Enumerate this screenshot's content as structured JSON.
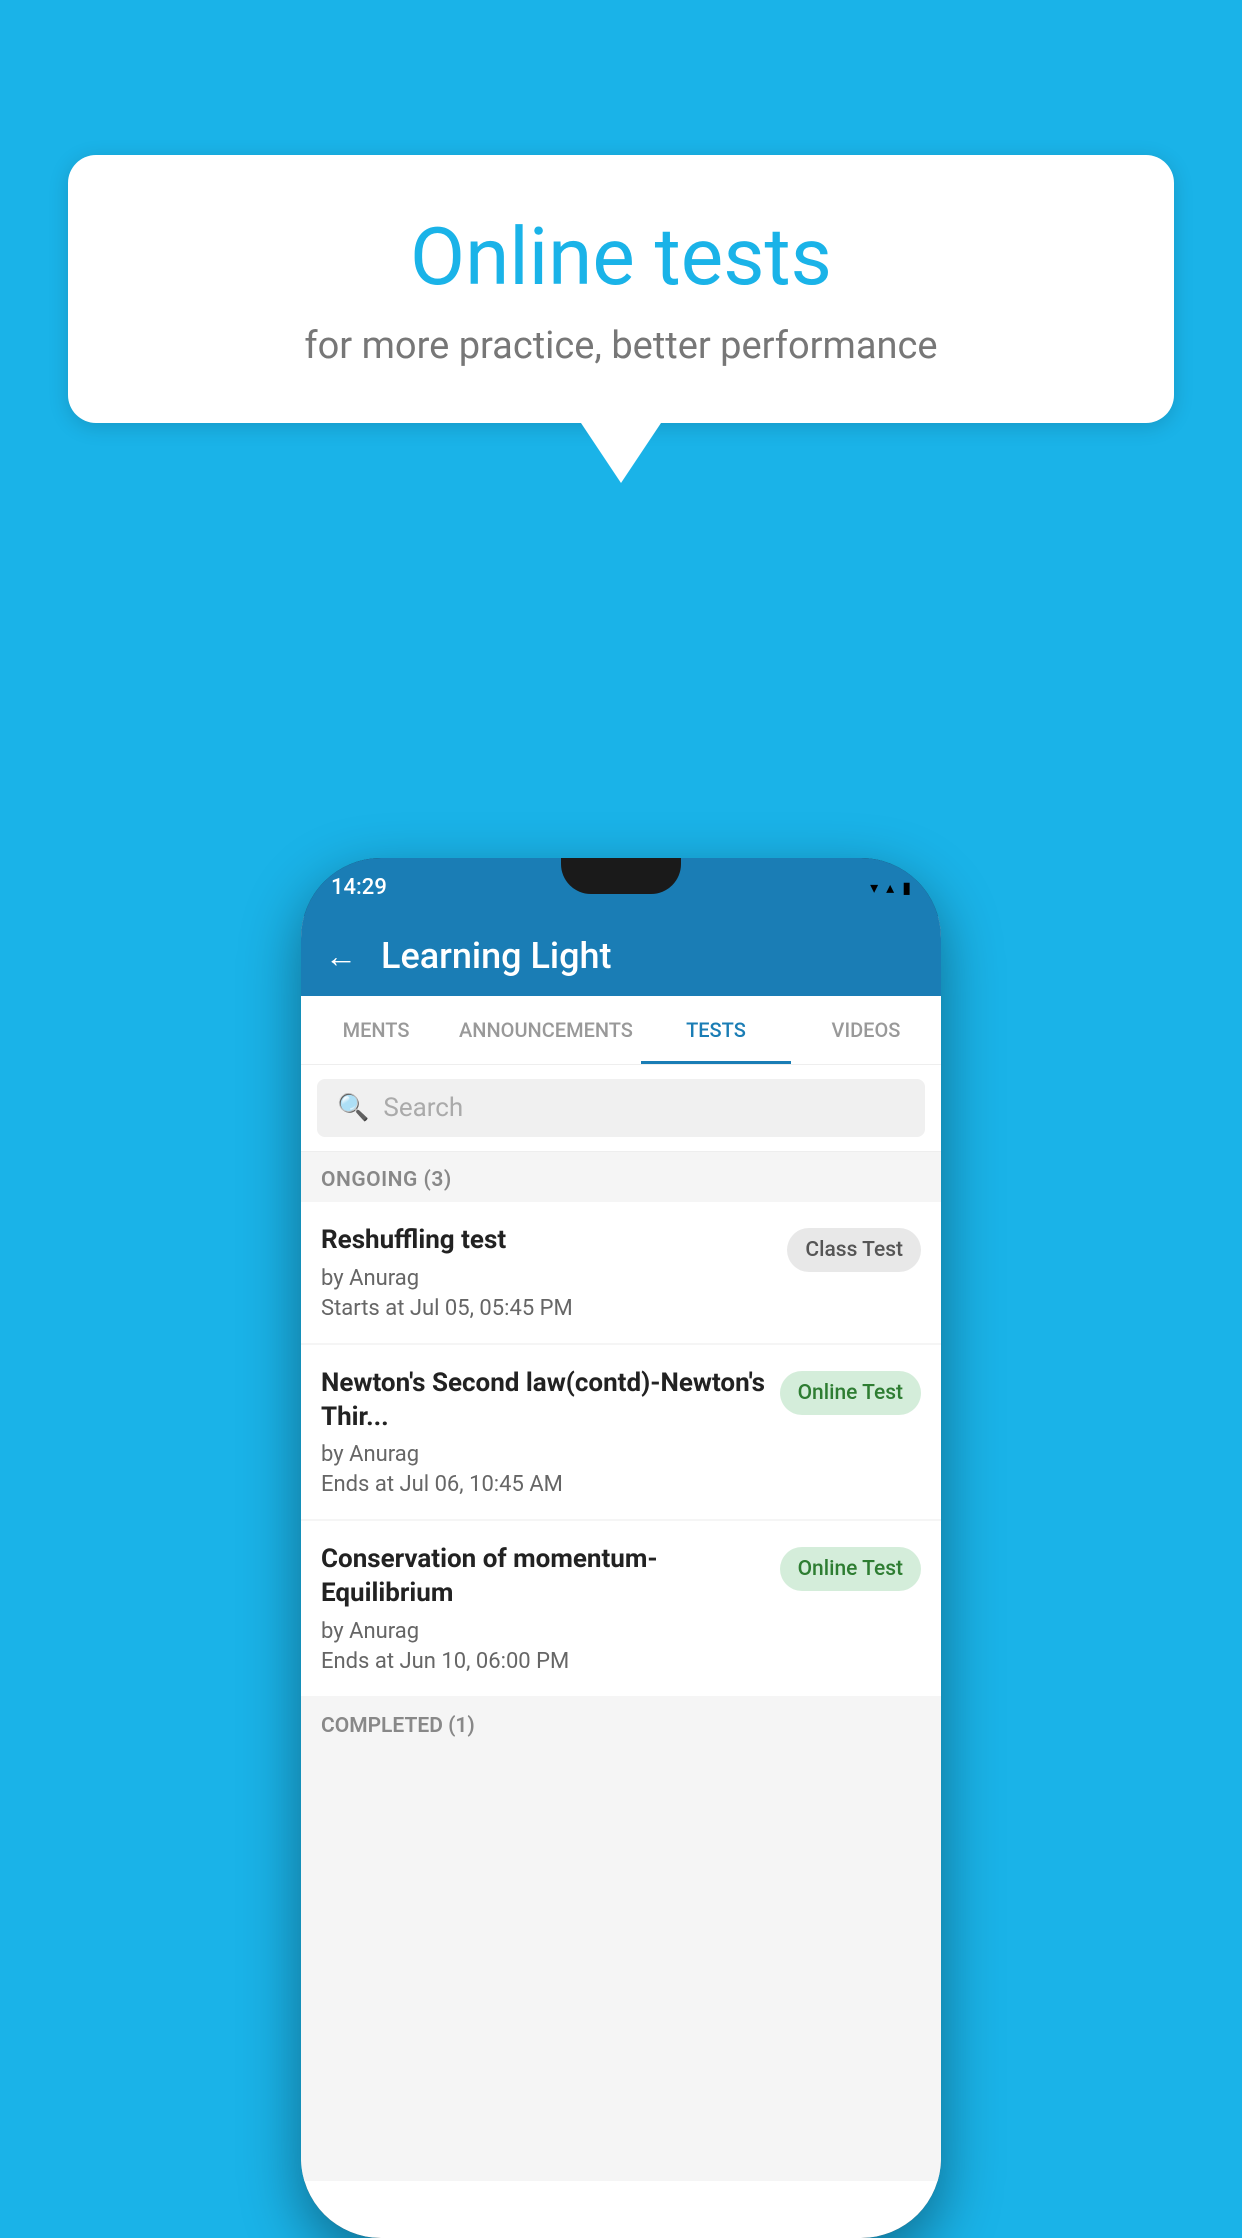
{
  "background_color": "#1ab3e8",
  "speech_bubble": {
    "title": "Online tests",
    "subtitle": "for more practice, better performance"
  },
  "phone": {
    "status_bar": {
      "time": "14:29",
      "wifi": "▼",
      "signal": "▲",
      "battery": "▐"
    },
    "app_bar": {
      "title": "Learning Light",
      "back_label": "←"
    },
    "tabs": [
      {
        "label": "MENTS",
        "active": false
      },
      {
        "label": "ANNOUNCEMENTS",
        "active": false
      },
      {
        "label": "TESTS",
        "active": true
      },
      {
        "label": "VIDEOS",
        "active": false
      }
    ],
    "search": {
      "placeholder": "Search"
    },
    "ongoing_section": {
      "header": "ONGOING (3)",
      "tests": [
        {
          "title": "Reshuffling test",
          "author": "by Anurag",
          "date": "Starts at  Jul 05, 05:45 PM",
          "badge": "Class Test",
          "badge_type": "class"
        },
        {
          "title": "Newton's Second law(contd)-Newton's Thir...",
          "author": "by Anurag",
          "date": "Ends at  Jul 06, 10:45 AM",
          "badge": "Online Test",
          "badge_type": "online"
        },
        {
          "title": "Conservation of momentum-Equilibrium",
          "author": "by Anurag",
          "date": "Ends at  Jun 10, 06:00 PM",
          "badge": "Online Test",
          "badge_type": "online"
        }
      ]
    },
    "completed_section": {
      "header": "COMPLETED (1)"
    }
  }
}
